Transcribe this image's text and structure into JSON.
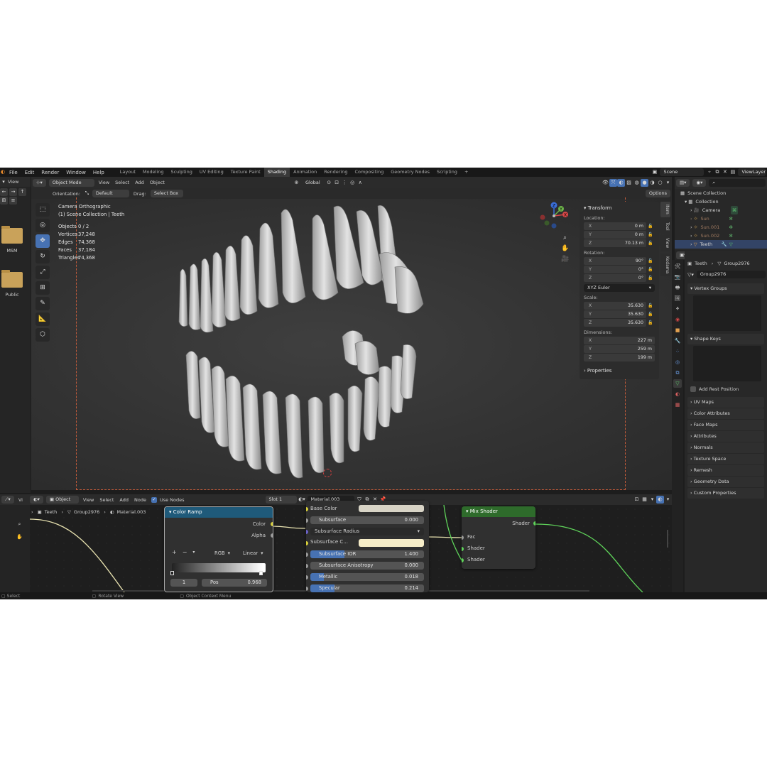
{
  "menu": {
    "items": [
      "File",
      "Edit",
      "Render",
      "Window",
      "Help"
    ]
  },
  "workspaces": {
    "tabs": [
      "Layout",
      "Modeling",
      "Sculpting",
      "UV Editing",
      "Texture Paint",
      "Shading",
      "Animation",
      "Rendering",
      "Compositing",
      "Geometry Nodes",
      "Scripting"
    ],
    "active": "Shading",
    "add": "+"
  },
  "topright": {
    "scene": "Scene",
    "view_layer": "ViewLayer"
  },
  "left_strip": {
    "view": "View",
    "folder1": "MSM",
    "folder2": "Public",
    "view2": "Vi"
  },
  "viewport_header": {
    "mode": "Object Mode",
    "menus": [
      "View",
      "Select",
      "Add",
      "Object"
    ],
    "transform": "Global",
    "options": "Options"
  },
  "tool_settings": {
    "orientation_label": "Orientation:",
    "orientation": "Default",
    "drag_label": "Drag:",
    "drag": "Select Box"
  },
  "overlay_text": {
    "line1": "Camera Orthographic",
    "line2": "(1) Scene Collection | Teeth"
  },
  "stats": [
    {
      "k": "Objects",
      "v": "0 / 2"
    },
    {
      "k": "Vertices",
      "v": "37,248"
    },
    {
      "k": "Edges",
      "v": "74,368"
    },
    {
      "k": "Faces",
      "v": "37,184"
    },
    {
      "k": "Triangles",
      "v": "74,368"
    }
  ],
  "gizmo": {
    "z": "Z",
    "y": "Y",
    "x": "X"
  },
  "n_panel": {
    "title": "Transform",
    "location_label": "Location:",
    "location": [
      {
        "ax": "X",
        "v": "0 m"
      },
      {
        "ax": "Y",
        "v": "0 m"
      },
      {
        "ax": "Z",
        "v": "70.13 m"
      }
    ],
    "rotation_label": "Rotation:",
    "rotation": [
      {
        "ax": "X",
        "v": "90°"
      },
      {
        "ax": "Y",
        "v": "0°"
      },
      {
        "ax": "Z",
        "v": "0°"
      }
    ],
    "rotation_mode": "XYZ Euler",
    "scale_label": "Scale:",
    "scale": [
      {
        "ax": "X",
        "v": "35.630"
      },
      {
        "ax": "Y",
        "v": "35.630"
      },
      {
        "ax": "Z",
        "v": "35.630"
      }
    ],
    "dimensions_label": "Dimensions:",
    "dimensions": [
      {
        "ax": "X",
        "v": "227 m"
      },
      {
        "ax": "Y",
        "v": "259 m"
      },
      {
        "ax": "Z",
        "v": "199 m"
      }
    ],
    "properties": "Properties"
  },
  "side_tabs": [
    "Item",
    "Tool",
    "View",
    "Kodama"
  ],
  "outliner": {
    "root": "Scene Collection",
    "collection": "Collection",
    "items": [
      "Camera",
      "Sun",
      "Sun.001",
      "Sun.002",
      "Teeth"
    ]
  },
  "properties": {
    "breadcrumb_obj": "Teeth",
    "breadcrumb_mesh": "Group2976",
    "mesh_name": "Group2976",
    "vertex_groups": "Vertex Groups",
    "shape_keys": "Shape Keys",
    "add_rest": "Add Rest Position",
    "panels": [
      "UV Maps",
      "Color Attributes",
      "Face Maps",
      "Attributes",
      "Normals",
      "Texture Space",
      "Remesh",
      "Geometry Data",
      "Custom Properties"
    ]
  },
  "node_header": {
    "view": "View",
    "object": "Object",
    "menus": [
      "View",
      "Select",
      "Add",
      "Node"
    ],
    "use_nodes": "Use Nodes",
    "slot": "Slot 1",
    "material": "Material.003"
  },
  "node_breadcrumb": {
    "obj": "Teeth",
    "mesh": "Group2976",
    "mat": "Material.003"
  },
  "color_ramp": {
    "title": "Color Ramp",
    "out_color": "Color",
    "out_alpha": "Alpha",
    "mode": "RGB",
    "interp": "Linear",
    "add": "+",
    "remove": "−",
    "index": "1",
    "pos_label": "Pos",
    "pos_value": "0.968"
  },
  "principled": {
    "base_color": "Base Color",
    "subsurface": "Subsurface",
    "subsurface_value": "0.000",
    "subsurface_radius": "Subsurface Radius",
    "subsurface_color": "Subsurface C...",
    "ior": "Subsurface IOR",
    "ior_value": "1.400",
    "aniso": "Subsurface Anisotropy",
    "aniso_value": "0.000",
    "metallic": "Metallic",
    "metallic_value": "0.018",
    "specular": "Specular",
    "specular_value": "0.214"
  },
  "mix_shader": {
    "title": "Mix Shader",
    "out": "Shader",
    "fac": "Fac",
    "in1": "Shader",
    "in2": "Shader"
  },
  "status": {
    "select": "Select",
    "rotate": "Rotate View",
    "context": "Object Context Menu"
  },
  "colors": {
    "accent": "#4772b3",
    "node_header_blue": "#1f5a7a",
    "node_header_green": "#2e6b2b",
    "wire_green": "#5fd35a",
    "wire_yellow": "#e8e2b0"
  }
}
